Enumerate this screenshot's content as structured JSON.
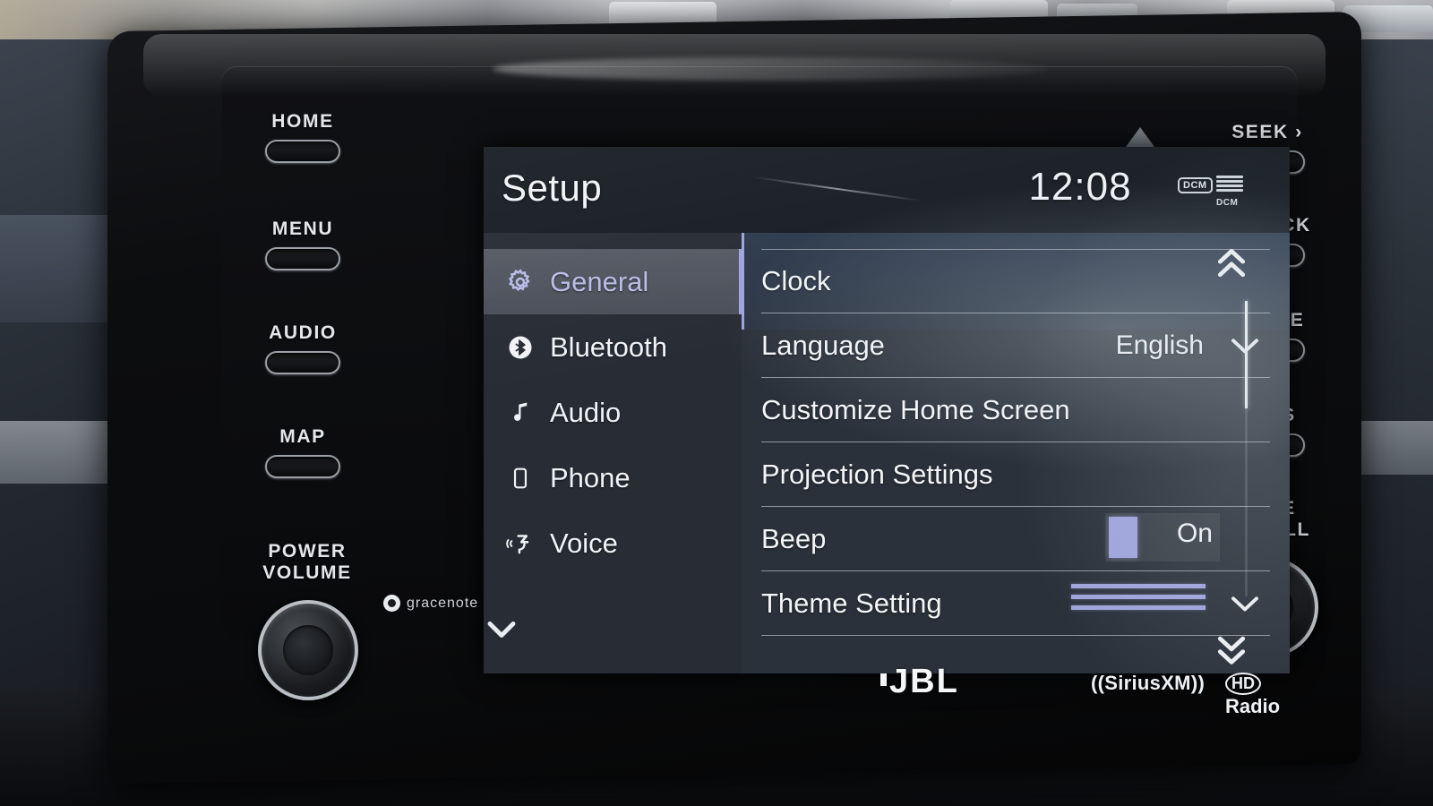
{
  "device": {
    "type": "car-infotainment-head-unit",
    "brand_bottom": {
      "jbl": "JBL",
      "siriusxm": "SiriusXM",
      "hd_radio_prefix": "HD",
      "hd_radio": "Radio",
      "gracenote": "gracenote"
    }
  },
  "bezel": {
    "left_buttons": [
      {
        "label": "HOME",
        "name": "home"
      },
      {
        "label": "MENU",
        "name": "menu"
      },
      {
        "label": "AUDIO",
        "name": "audio"
      },
      {
        "label": "MAP",
        "name": "map"
      }
    ],
    "left_knob": {
      "line1": "POWER",
      "line2": "VOLUME"
    },
    "right_buttons": [
      {
        "label": "SEEK ›",
        "name": "seek"
      },
      {
        "label": "‹ TRACK",
        "name": "track"
      },
      {
        "label": "PHONE",
        "name": "phone"
      },
      {
        "label": "APPS",
        "name": "apps"
      }
    ],
    "right_knob": {
      "line1": "TUNE",
      "line2": "SCROLL"
    }
  },
  "screen": {
    "status": {
      "title": "Setup",
      "clock": "12:08",
      "dcm_badge": "DCM",
      "dcm_signal_label": "DCM"
    },
    "sidebar": {
      "items": [
        {
          "label": "General",
          "icon": "gear-icon",
          "active": true
        },
        {
          "label": "Bluetooth",
          "icon": "bluetooth-icon",
          "active": false
        },
        {
          "label": "Audio",
          "icon": "music-note-icon",
          "active": false
        },
        {
          "label": "Phone",
          "icon": "phone-icon",
          "active": false
        },
        {
          "label": "Voice",
          "icon": "voice-icon",
          "active": false
        }
      ],
      "more_icon": "chevron-down-icon"
    },
    "settings": {
      "rows": [
        {
          "label": "Clock",
          "type": "link",
          "value": "",
          "control": "none"
        },
        {
          "label": "Language",
          "type": "select",
          "value": "English",
          "control": "chevron-down-icon"
        },
        {
          "label": "Customize Home Screen",
          "type": "link",
          "value": "",
          "control": "none"
        },
        {
          "label": "Projection Settings",
          "type": "link",
          "value": "",
          "control": "none"
        },
        {
          "label": "Beep",
          "type": "toggle",
          "value": "On",
          "control": "toggle"
        },
        {
          "label": "Theme Setting",
          "type": "select",
          "value": "",
          "control": "theme-bars"
        }
      ]
    },
    "scrollbar": {
      "up_icon": "double-chevron-up-icon",
      "down_icon": "double-chevron-down-icon"
    },
    "colors": {
      "accent": "#9fa4dc",
      "accent_text": "#b9bde6",
      "screen_bg": "#2a313a",
      "sidebar_bg": "#272c35",
      "statusbar_bg": "#181d24",
      "text": "#f3f5f7"
    }
  }
}
